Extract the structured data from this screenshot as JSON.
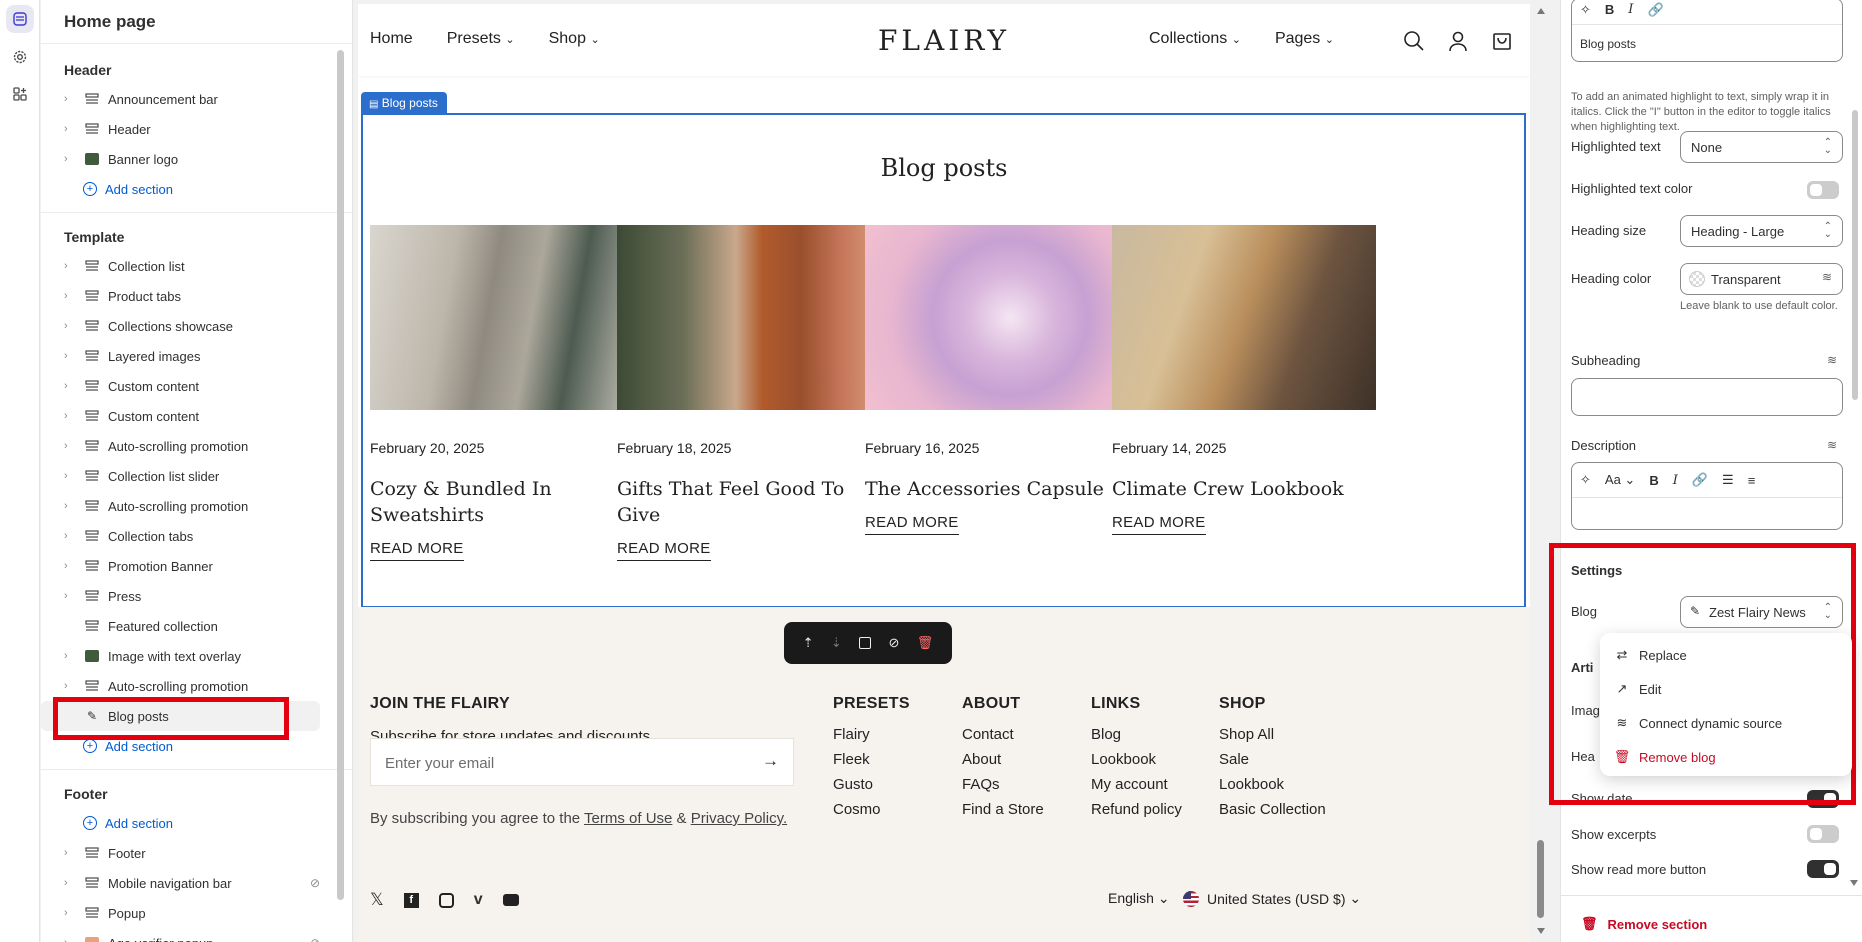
{
  "left_panel": {
    "title": "Home page",
    "header_group": "Header",
    "header_items": [
      "Announcement bar",
      "Header",
      "Banner logo"
    ],
    "template_group": "Template",
    "template_items": [
      "Collection list",
      "Product tabs",
      "Collections showcase",
      "Layered images",
      "Custom content",
      "Custom content",
      "Auto-scrolling promotion",
      "Collection list slider",
      "Auto-scrolling promotion",
      "Collection tabs",
      "Promotion Banner",
      "Press",
      "Featured collection",
      "Image with text overlay",
      "Auto-scrolling promotion",
      "Blog posts"
    ],
    "footer_group": "Footer",
    "footer_items": [
      "Footer",
      "Mobile navigation bar",
      "Popup",
      "Age verifier popup"
    ],
    "add_section": "Add section"
  },
  "store": {
    "nav_left": [
      "Home",
      "Presets",
      "Shop"
    ],
    "logo": "FLAIRY",
    "nav_right": [
      "Collections",
      "Pages"
    ],
    "section_tag": "Blog posts",
    "section_title": "Blog posts",
    "posts": [
      {
        "date": "February 20, 2025",
        "title": "Cozy & Bundled In Sweatshirts",
        "cta": "READ MORE"
      },
      {
        "date": "February 18, 2025",
        "title": "Gifts That Feel Good To Give",
        "cta": "READ MORE"
      },
      {
        "date": "February 16, 2025",
        "title": "The Accessories Capsule",
        "cta": "READ MORE"
      },
      {
        "date": "February 14, 2025",
        "title": "Climate Crew Lookbook",
        "cta": "READ MORE"
      }
    ],
    "footer": {
      "join_title": "JOIN THE FLAIRY",
      "join_text": "Subscribe for store updates and discounts.",
      "email_placeholder": "Enter your email",
      "legal_prefix": "By subscribing you agree to the ",
      "terms": "Terms of Use",
      "amp": " & ",
      "privacy": "Privacy Policy.",
      "columns": [
        {
          "title": "PRESETS",
          "links": [
            "Flairy",
            "Fleek",
            "Gusto",
            "Cosmo"
          ]
        },
        {
          "title": "ABOUT",
          "links": [
            "Contact",
            "About",
            "FAQs",
            "Find a Store"
          ]
        },
        {
          "title": "LINKS",
          "links": [
            "Blog",
            "Lookbook",
            "My account",
            "Refund policy"
          ]
        },
        {
          "title": "SHOP",
          "links": [
            "Shop All",
            "Sale",
            "Lookbook",
            "Basic Collection"
          ]
        }
      ],
      "language": "English",
      "currency": "United States (USD $)"
    }
  },
  "settings_panel": {
    "heading_value": "Blog posts",
    "highlight_help": "To add an animated highlight to text, simply wrap it in italics. Click the \"I\" button in the editor to toggle italics when highlighting text.",
    "highlighted_text_label": "Highlighted text",
    "highlighted_text_value": "None",
    "highlighted_text_color_label": "Highlighted text color",
    "heading_size_label": "Heading size",
    "heading_size_value": "Heading - Large",
    "heading_color_label": "Heading color",
    "heading_color_value": "Transparent",
    "heading_color_help": "Leave blank to use default color.",
    "subheading_label": "Subheading",
    "description_label": "Description",
    "font_menu": "Aa",
    "settings_title": "Settings",
    "blog_label": "Blog",
    "blog_value": "Zest Flairy News",
    "articles_partial": "Arti",
    "image_partial": "Imag",
    "heading_partial": "Hea",
    "show_date_partial": "Show date",
    "show_excerpts": "Show excerpts",
    "show_read_more": "Show read more button",
    "remove_section": "Remove section"
  },
  "popup_menu": {
    "items": [
      "Replace",
      "Edit",
      "Connect dynamic source"
    ],
    "danger": "Remove blog"
  },
  "colors": {
    "accent_blue": "#2c6ecb",
    "highlight_red": "#e3000f",
    "danger": "#c70a24"
  }
}
